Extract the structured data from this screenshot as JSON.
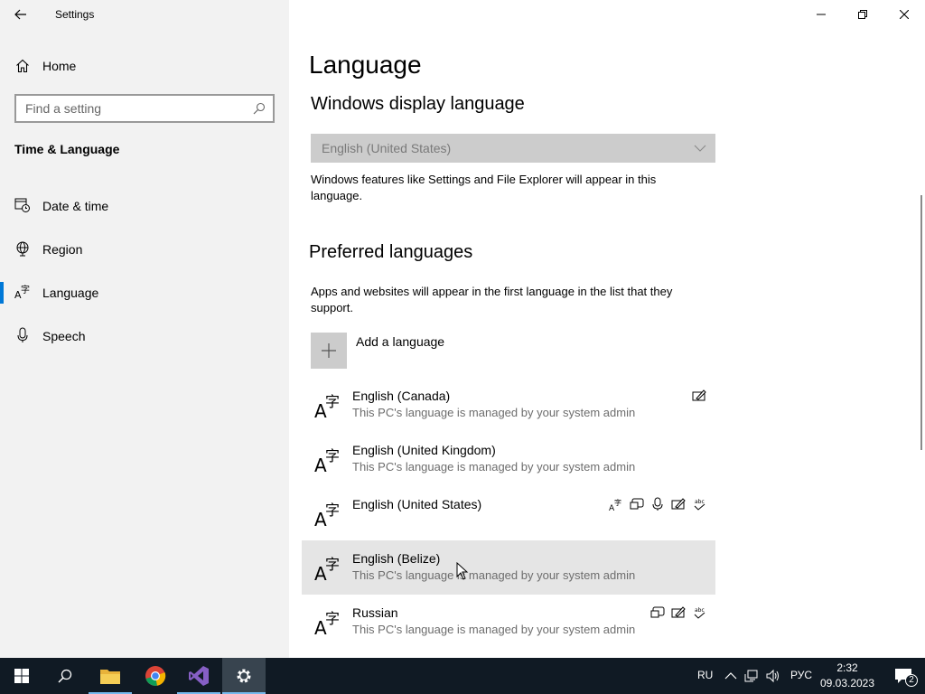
{
  "window": {
    "title": "Settings"
  },
  "sidebar": {
    "home_label": "Home",
    "search_placeholder": "Find a setting",
    "section_title": "Time & Language",
    "items": [
      {
        "label": "Date & time",
        "icon": "calendar-clock-icon"
      },
      {
        "label": "Region",
        "icon": "globe-icon"
      },
      {
        "label": "Language",
        "icon": "language-icon",
        "active": true
      },
      {
        "label": "Speech",
        "icon": "microphone-icon"
      }
    ]
  },
  "main": {
    "page_title": "Language",
    "display_language": {
      "heading": "Windows display language",
      "selected": "English (United States)",
      "description": "Windows features like Settings and File Explorer will appear in this language."
    },
    "preferred": {
      "heading": "Preferred languages",
      "description": "Apps and websites will appear in the first language in the list that they support.",
      "add_label": "Add a language",
      "languages": [
        {
          "name": "English (Canada)",
          "note": "This PC's language is managed by your system admin",
          "features": [
            "handwriting-icon"
          ]
        },
        {
          "name": "English (United Kingdom)",
          "note": "This PC's language is managed by your system admin",
          "features": []
        },
        {
          "name": "English (United States)",
          "note": "",
          "features": [
            "display-language-icon",
            "text-to-speech-icon",
            "speech-recognition-icon",
            "handwriting-icon",
            "spellcheck-icon"
          ]
        },
        {
          "name": "English (Belize)",
          "note": "This PC's language is managed by your system admin",
          "features": [],
          "hover": true
        },
        {
          "name": "Russian",
          "note": "This PC's language is managed by your system admin",
          "features": [
            "text-to-speech-icon",
            "handwriting-icon",
            "spellcheck-icon"
          ]
        }
      ]
    }
  },
  "taskbar": {
    "input_language": "RU",
    "keyboard_layout": "РУС",
    "time": "2:32",
    "date": "09.03.2023",
    "notification_count": "2"
  },
  "colors": {
    "accent": "#0078d7",
    "sidebar_bg": "#f2f2f2",
    "taskbar_bg": "#101a24"
  }
}
